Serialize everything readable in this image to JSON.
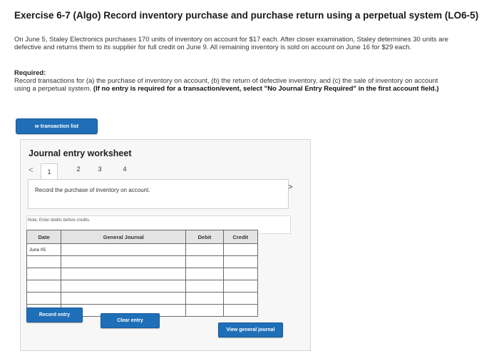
{
  "exercise": {
    "title": "Exercise 6-7 (Algo) Record inventory purchase and purchase return using a perpetual system (LO6-5)",
    "intro": "On June 5, Staley Electronics purchases 170 units of inventory on account for $17 each. After closer examination, Staley determines 30 units are defective and returns them to its supplier for full credit on June 9. All remaining inventory is sold on account on June 16 for $29 each.",
    "required_label": "Required:",
    "required_text": "Record transactions for (a) the purchase of inventory on account, (b) the return of defective inventory, and (c) the sale of inventory on account using a perpetual system.",
    "required_bold": "(If no entry is required for a transaction/event, select \"No Journal Entry Required\" in the first account field.)"
  },
  "buttons": {
    "view_transaction_list": "w transaction list",
    "record_entry": "Record entry",
    "clear_entry": "Clear entry",
    "view_general_journal": "View general journal"
  },
  "worksheet": {
    "title": "Journal entry worksheet",
    "prev_arrow": "<",
    "next_arrow": ">",
    "tabs": [
      "1",
      "2",
      "3",
      "4"
    ],
    "active_tab": "1",
    "instruction": "Record the purchase of inventory on account.",
    "note": "Note: Enter debits before credits."
  },
  "journal_table": {
    "headers": {
      "date": "Date",
      "general_journal": "General Journal",
      "debit": "Debit",
      "credit": "Credit"
    },
    "first_date": "June 05"
  }
}
